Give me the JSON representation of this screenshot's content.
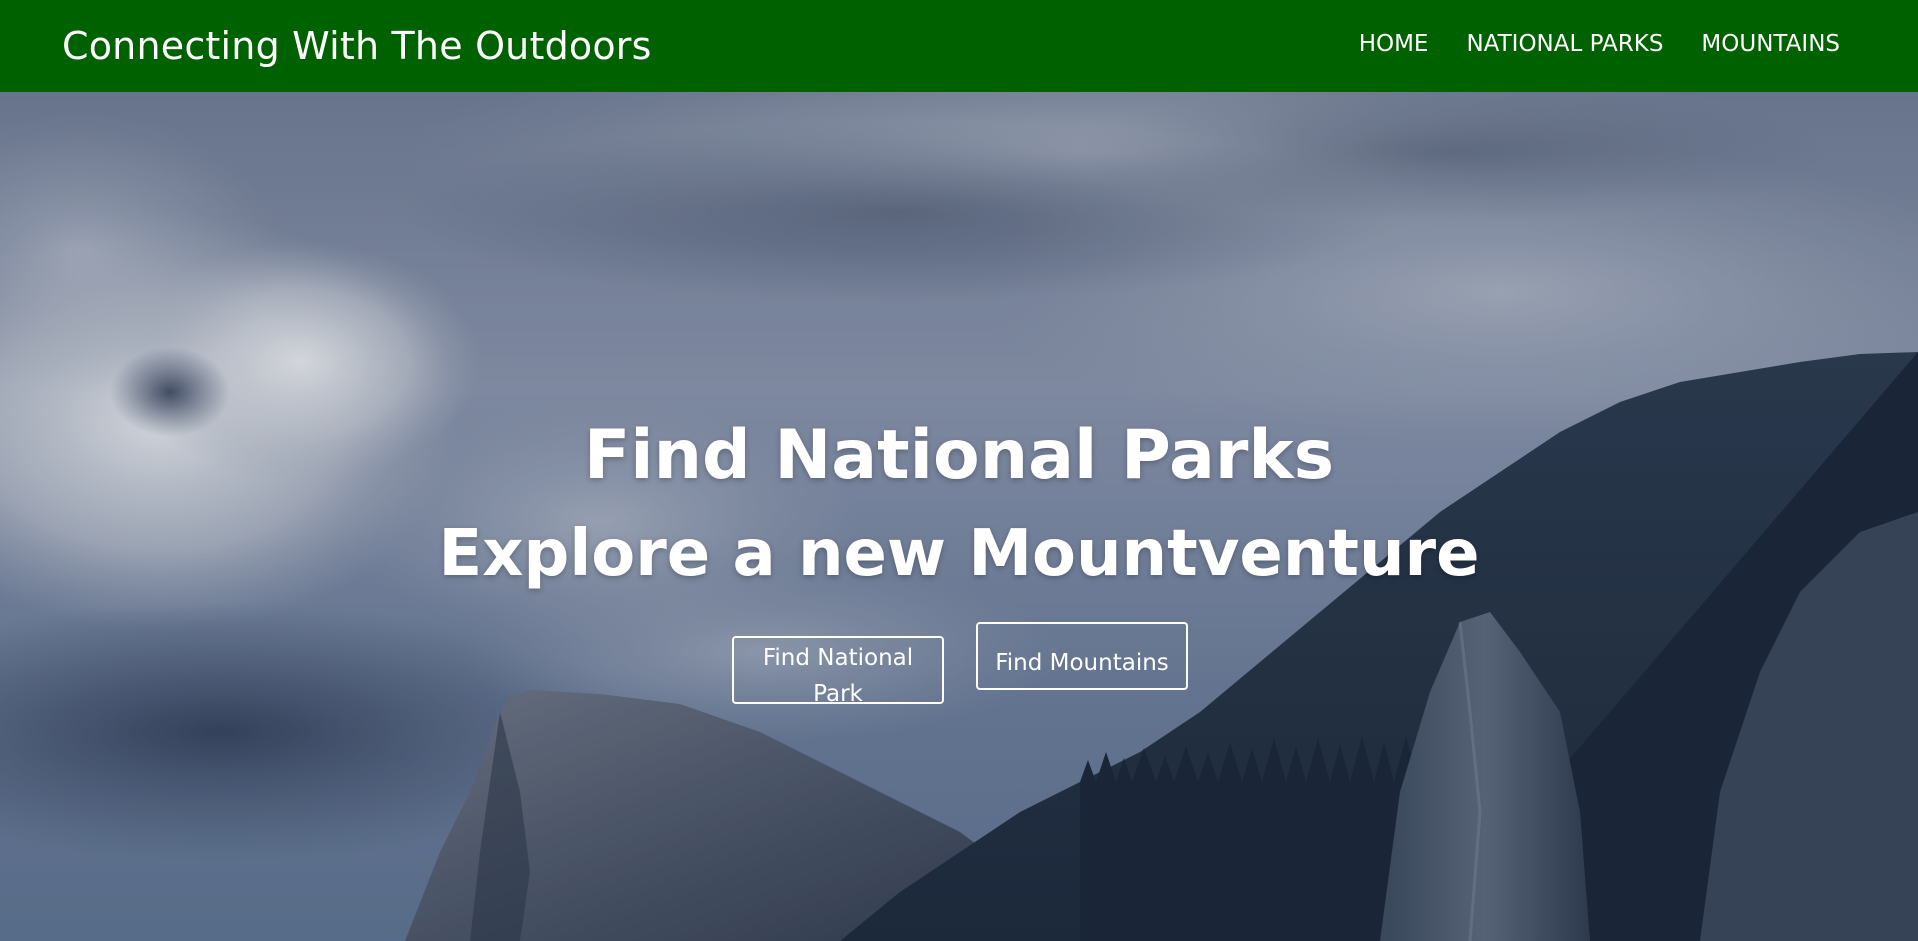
{
  "navbar": {
    "brand": "Connecting With The Outdoors",
    "links": [
      {
        "label": "HOME"
      },
      {
        "label": "NATIONAL PARKS"
      },
      {
        "label": "MOUNTAINS"
      }
    ],
    "background_color": "#006100"
  },
  "hero": {
    "title": "Find National Parks",
    "subtitle": "Explore a new Mountventure",
    "buttons": [
      {
        "label": "Find National Park"
      },
      {
        "label": "Find Mountains"
      }
    ]
  }
}
